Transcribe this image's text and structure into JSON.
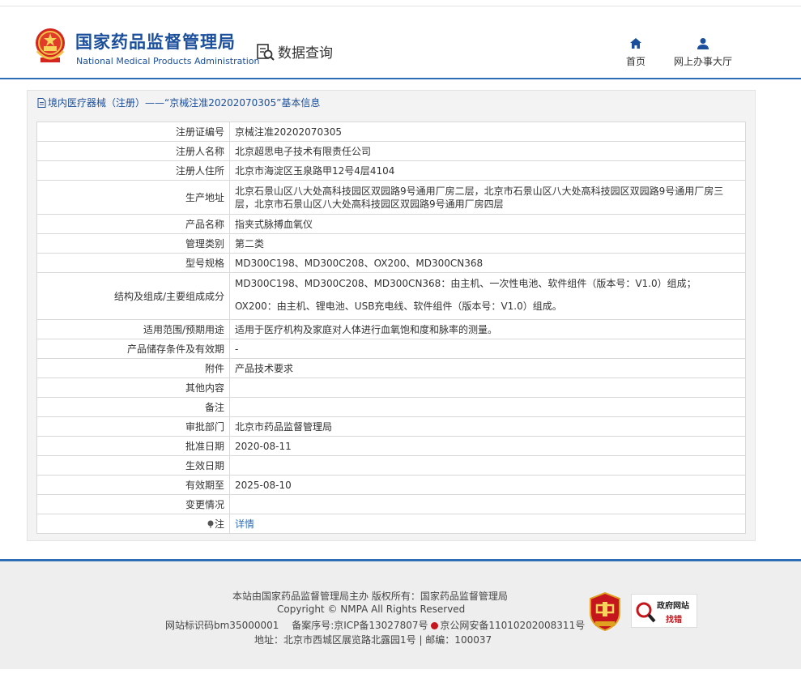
{
  "header": {
    "brand_cn": "国家药品监督管理局",
    "brand_en": "National Medical Products Administration",
    "section": "数据查询",
    "nav": {
      "home": "首页",
      "hall": "网上办事大厅"
    },
    "accent": "#1b4f9c"
  },
  "panel": {
    "title": "境内医疗器械（注册）——“京械注准20202070305”基本信息"
  },
  "details": {
    "reg_no": {
      "label": "注册证编号",
      "value": "京械注准20202070305"
    },
    "registrant": {
      "label": "注册人名称",
      "value": "北京超思电子技术有限责任公司"
    },
    "residence": {
      "label": "注册人住所",
      "value": "北京市海淀区玉泉路甲12号4层4104"
    },
    "prod_addr": {
      "label": "生产地址",
      "value": "北京石景山区八大处高科技园区双园路9号通用厂房二层，北京市石景山区八大处高科技园区双园路9号通用厂房三层，北京市石景山区八大处高科技园区双园路9号通用厂房四层"
    },
    "product": {
      "label": "产品名称",
      "value": "指夹式脉搏血氧仪"
    },
    "category": {
      "label": "管理类别",
      "value": "第二类"
    },
    "model": {
      "label": "型号规格",
      "value": "MD300C198、MD300C208、OX200、MD300CN368"
    },
    "structure": {
      "label": "结构及组成/主要组成成分",
      "value1": "MD300C198、MD300C208、MD300CN368：由主机、一次性电池、软件组件（版本号：V1.0）组成；",
      "value2": "OX200：由主机、锂电池、USB充电线、软件组件（版本号：V1.0）组成。"
    },
    "scope": {
      "label": "适用范围/预期用途",
      "value": "适用于医疗机构及家庭对人体进行血氧饱和度和脉率的测量。"
    },
    "storage": {
      "label": "产品储存条件及有效期",
      "value": "-"
    },
    "attachment": {
      "label": "附件",
      "value": "产品技术要求"
    },
    "other": {
      "label": "其他内容",
      "value": ""
    },
    "remark": {
      "label": "备注",
      "value": ""
    },
    "approver": {
      "label": "审批部门",
      "value": "北京市药品监督管理局"
    },
    "approve_date": {
      "label": "批准日期",
      "value": "2020-08-11"
    },
    "effective_date": {
      "label": "生效日期",
      "value": ""
    },
    "expire": {
      "label": "有效期至",
      "value": "2025-08-10"
    },
    "change": {
      "label": "变更情况",
      "value": ""
    },
    "note": {
      "label": "注",
      "value": "详情"
    }
  },
  "footer": {
    "line1": "本站由国家药品监督管理局主办 版权所有：国家药品监督管理局",
    "line2": "Copyright © NMPA All Rights Reserved",
    "line3a": "网站标识码bm35000001　 备案序号:京ICP备13027807号",
    "line3b": "京公网安备11010202008311号",
    "line4": "地址：北京市西城区展览路北露园1号 | 邮编：100037",
    "gov_badge_t1": "政府网站",
    "gov_badge_t2": "找错"
  }
}
